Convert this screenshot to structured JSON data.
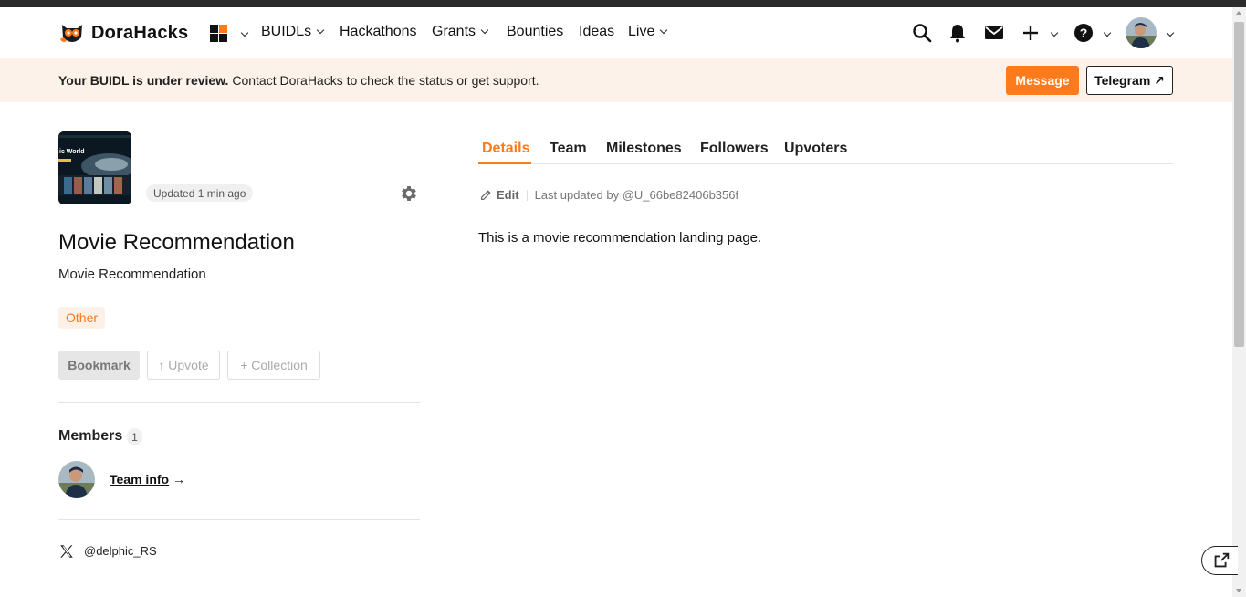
{
  "header": {
    "logo_text": "DoraHacks",
    "nav": {
      "buidls": "BUIDLs",
      "hackathons": "Hackathons",
      "grants": "Grants",
      "bounties": "Bounties",
      "ideas": "Ideas",
      "live": "Live"
    },
    "icons": [
      "apps-grid-icon",
      "search-icon",
      "bell-icon",
      "mail-icon",
      "plus-icon",
      "help-icon",
      "avatar"
    ]
  },
  "banner": {
    "bold": "Your BUIDL is under review.",
    "text": " Contact DoraHacks to check the status or get support.",
    "message_label": "Message",
    "telegram_label": "Telegram ↗"
  },
  "project": {
    "thumbnail_caption": "ic World",
    "updated_badge": "Updated 1 min ago",
    "title": "Movie Recommendation",
    "subtitle": "Movie Recommendation",
    "tag": "Other",
    "bookmark_label": "Bookmark",
    "upvote_label": "↑ Upvote",
    "collection_label": "+ Collection",
    "members_title": "Members",
    "members_count": "1",
    "team_info_label": "Team info",
    "team_info_arrow": " →",
    "twitter_handle": "@delphic_RS"
  },
  "tabs": [
    {
      "label": "Details",
      "active": true
    },
    {
      "label": "Team",
      "active": false
    },
    {
      "label": "Milestones",
      "active": false
    },
    {
      "label": "Followers",
      "active": false
    },
    {
      "label": "Upvoters",
      "active": false
    }
  ],
  "details": {
    "edit_label": "Edit",
    "last_updated": "Last updated by @U_66be82406b356f",
    "body": "This is a movie recommendation landing page."
  },
  "colors": {
    "accent": "#ff7a1a",
    "banner_bg": "#fdf2ea",
    "text": "#111111"
  }
}
